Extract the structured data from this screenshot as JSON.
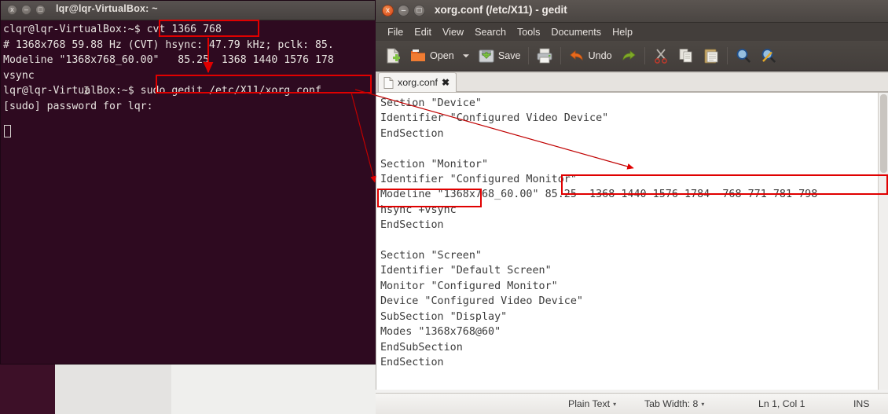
{
  "terminal": {
    "window_title": "lqr@lqr-VirtualBox: ~",
    "buttons": {
      "close": "x",
      "minimize": "–",
      "maximize": "□"
    },
    "lines": [
      "clqr@lqr-VirtualBox:~$ cvt 1366 768",
      "# 1368x768 59.88 Hz (CVT) hsync: 47.79 kHz; pclk: 85.",
      "Modeline \"1368x768_60.00\"   85.25  1368 1440 1576 178",
      "vsync",
      "lqr@lqr-VirtualBox:~$ sudo gedit /etc/X11/xorg.conf",
      "[sudo] password for lqr:"
    ],
    "text_block": "clqr@lqr-VirtualBox:~$ cvt 1366 768\n# 1368x768 59.88 Hz (CVT) hsync: 47.79 kHz; pclk: 85.\nModeline \"1368x768_60.00\"   85.25  1368 1440 1576 178\nvsync\nlqr@lqr-VirtualBox:~$ sudo gedit /etc/X11/xorg.conf\n[sudo] password for lqr:",
    "highlight_1": "cvt 1366 768",
    "highlight_2": "sudo gedit /etc/X11/xorg.conf",
    "cursor": "block-cursor"
  },
  "gedit": {
    "window_title": "xorg.conf (/etc/X11) - gedit",
    "buttons": {
      "close": "x",
      "minimize": "–",
      "maximize": "□"
    },
    "menus": [
      "File",
      "Edit",
      "View",
      "Search",
      "Tools",
      "Documents",
      "Help"
    ],
    "toolbar": {
      "new_label": "",
      "open_label": "Open",
      "save_label": "Save",
      "undo_label": "Undo",
      "icons": [
        "new-document-icon",
        "open-folder-icon",
        "open-dropdown-caret",
        "save-icon",
        "print-icon",
        "undo-icon",
        "redo-icon",
        "cut-icon",
        "copy-icon",
        "paste-icon",
        "find-icon",
        "replace-icon"
      ]
    },
    "tab": {
      "label": "xorg.conf",
      "close": "✖"
    },
    "document": "Section \"Device\"\nIdentifier \"Configured Video Device\"\nEndSection\n\nSection \"Monitor\"\nIdentifier \"Configured Monitor\"\nModeline \"1368x768_60.00\" 85.25  1368 1440 1576 1784  768 771 781 798 -\nhsync +vsync\nEndSection\n\nSection \"Screen\"\nIdentifier \"Default Screen\"\nMonitor \"Configured Monitor\"\nDevice \"Configured Video Device\"\nSubSection \"Display\"\nModes \"1368x768@60\"\nEndSubSection\nEndSection",
    "document_lines": [
      "Section \"Device\"",
      "Identifier \"Configured Video Device\"",
      "EndSection",
      "",
      "Section \"Monitor\"",
      "Identifier \"Configured Monitor\"",
      "Modeline \"1368x768_60.00\" 85.25  1368 1440 1576 1784  768 771 781 798 -",
      "hsync +vsync",
      "EndSection",
      "",
      "Section \"Screen\"",
      "Identifier \"Default Screen\"",
      "Monitor \"Configured Monitor\"",
      "Device \"Configured Video Device\"",
      "SubSection \"Display\"",
      "Modes \"1368x768@60\"",
      "EndSubSection",
      "EndSection"
    ],
    "highlight_modeline_values": "85.25  1368 1440 1576 1784  768 771 781 798 -",
    "highlight_hsync": "hsync +vsync",
    "statusbar": {
      "language": "Plain Text",
      "tab_width": "Tab Width: 8",
      "position": "Ln 1, Col 1",
      "insert_mode": "INS",
      "caret": "▾"
    }
  },
  "annotations": {
    "color": "#e00000",
    "boxes": [
      "cvt-command-box",
      "sudo-gedit-box",
      "modeline-values-box",
      "hsync-vsync-box"
    ],
    "arrows": [
      "arrow-to-sudo-command",
      "arrow-to-modeline-values",
      "arrow-to-modeline-start"
    ]
  }
}
